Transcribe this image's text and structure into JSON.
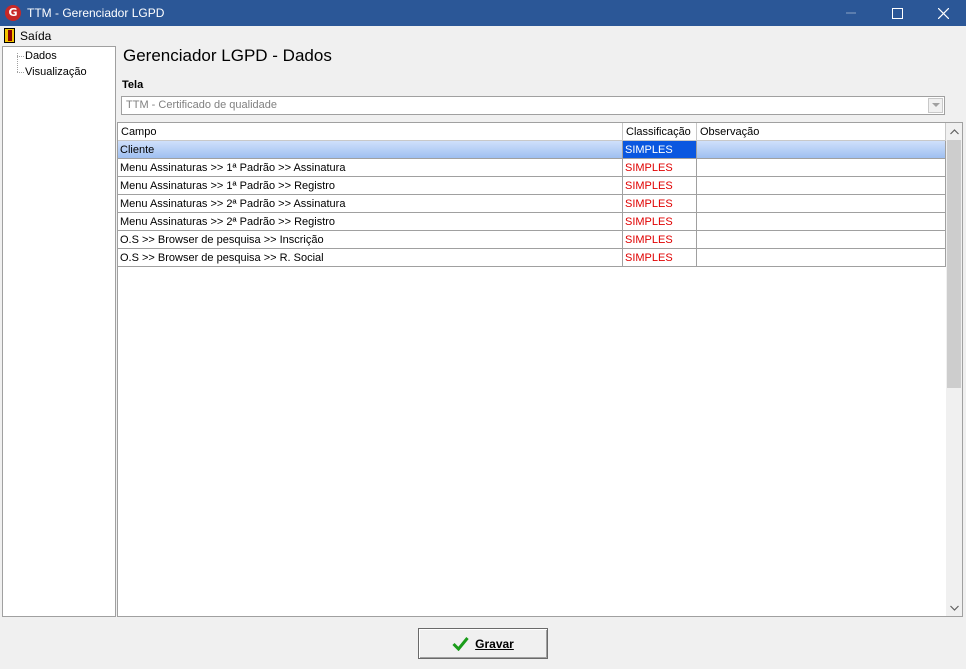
{
  "window": {
    "title": "TTM - Gerenciador LGPD"
  },
  "menu": {
    "exit_label": "Saída"
  },
  "sidebar": {
    "items": [
      {
        "label": "Dados"
      },
      {
        "label": "Visualização"
      }
    ]
  },
  "page": {
    "title": "Gerenciador LGPD - Dados"
  },
  "tela": {
    "label": "Tela",
    "selected": "TTM - Certificado de qualidade"
  },
  "grid": {
    "columns": [
      "Campo",
      "Classificação",
      "Observação"
    ],
    "rows": [
      {
        "campo": "Cliente",
        "classificacao": "SIMPLES",
        "observacao": "",
        "selected": true
      },
      {
        "campo": "Menu Assinaturas >> 1ª Padrão >> Assinatura",
        "classificacao": "SIMPLES",
        "observacao": ""
      },
      {
        "campo": "Menu Assinaturas >> 1ª Padrão >> Registro",
        "classificacao": "SIMPLES",
        "observacao": ""
      },
      {
        "campo": "Menu Assinaturas >> 2ª Padrão >> Assinatura",
        "classificacao": "SIMPLES",
        "observacao": ""
      },
      {
        "campo": "Menu Assinaturas >> 2ª Padrão >> Registro",
        "classificacao": "SIMPLES",
        "observacao": ""
      },
      {
        "campo": "O.S >> Browser de pesquisa >> Inscrição",
        "classificacao": "SIMPLES",
        "observacao": ""
      },
      {
        "campo": "O.S >> Browser de pesquisa >> R. Social",
        "classificacao": "SIMPLES",
        "observacao": ""
      }
    ]
  },
  "footer": {
    "save_label": "Gravar"
  },
  "colors": {
    "titlebar": "#2b5797",
    "classification_text": "#e00000",
    "selected_cell": "#0a57e0"
  }
}
